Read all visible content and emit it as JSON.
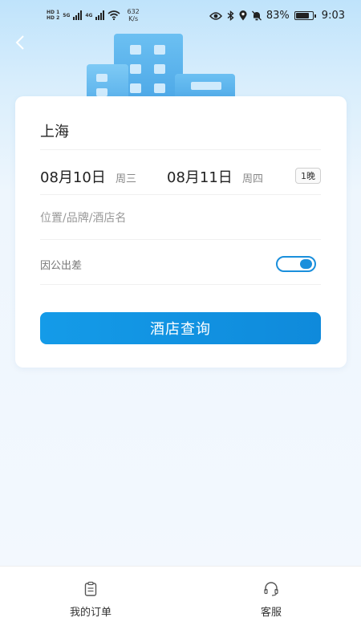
{
  "status_bar": {
    "sim1": "HD 1",
    "sim2": "HD 2",
    "net1": "5G",
    "net2": "4G",
    "speed_value": "632",
    "speed_unit": "K/s",
    "battery": "83%",
    "battery_level": 0.83,
    "time": "9:03"
  },
  "header": {
    "back_icon": "chevron-left-icon"
  },
  "search_form": {
    "city": "上海",
    "checkin_date": "08月10日",
    "checkin_weekday": "周三",
    "checkout_date": "08月11日",
    "checkout_weekday": "周四",
    "nights": "1晚",
    "keyword_placeholder": "位置/品牌/酒店名",
    "keyword_value": "",
    "business_trip_label": "因公出差",
    "business_trip_on": true,
    "submit_label": "酒店查询"
  },
  "tabbar": {
    "items": [
      {
        "label": "我的订单",
        "icon": "clipboard-icon"
      },
      {
        "label": "客服",
        "icon": "headset-icon"
      }
    ]
  },
  "colors": {
    "accent": "#149be8",
    "card_bg": "#ffffff",
    "page_bg": "#f2f7fd"
  }
}
